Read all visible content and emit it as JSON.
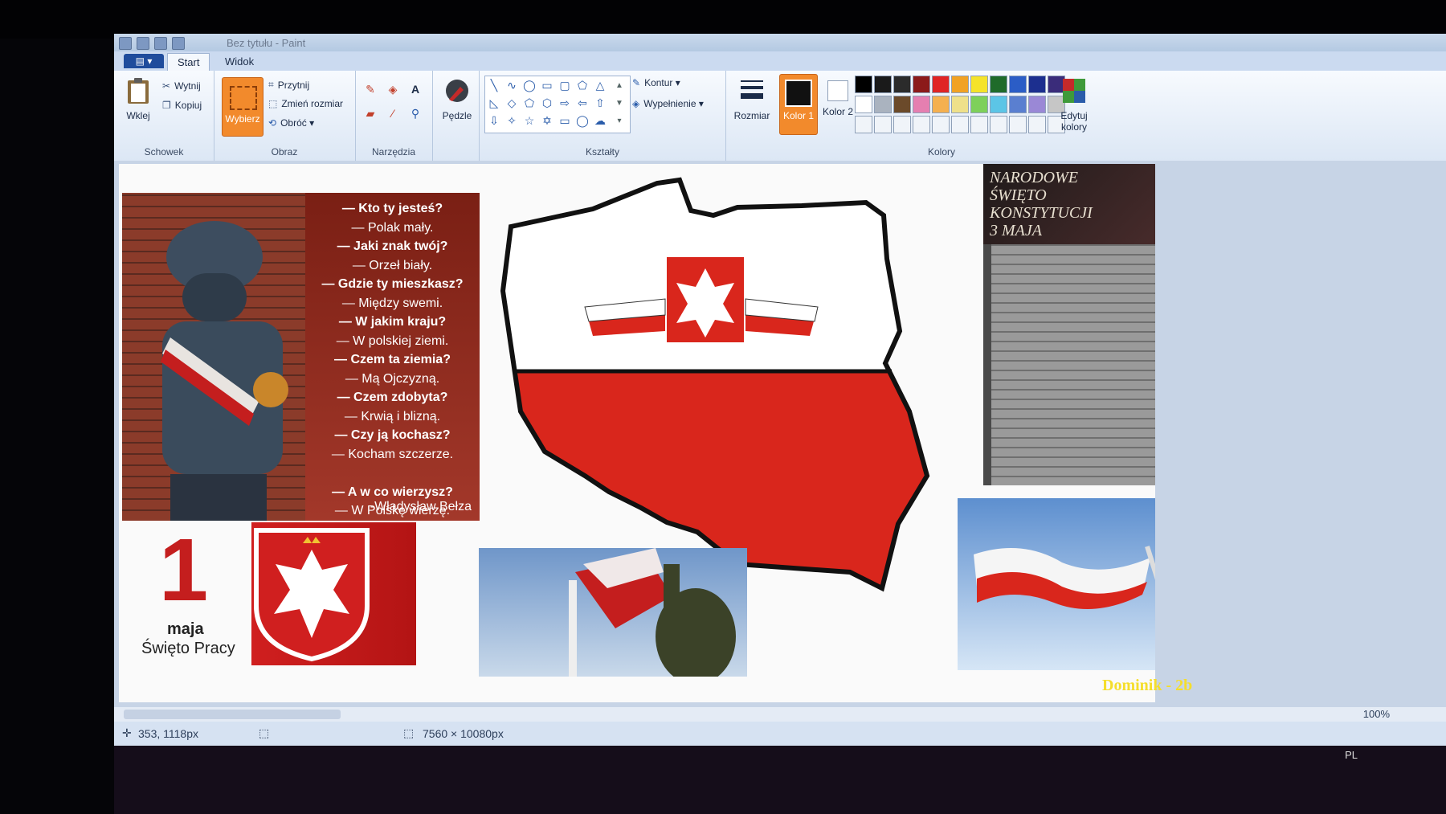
{
  "window": {
    "title": "Bez tytułu - Paint"
  },
  "tabs": {
    "file": "▤ ▾",
    "start": "Start",
    "view": "Widok"
  },
  "clipboard": {
    "paste": "Wklej",
    "cut": "Wytnij",
    "copy": "Kopiuj",
    "label": "Schowek"
  },
  "image": {
    "select": "Wybierz",
    "crop": "Przytnij",
    "resize": "Zmień rozmiar",
    "rotate": "Obróć ▾",
    "label": "Obraz"
  },
  "tools": {
    "label": "Narzędzia",
    "brushes": "Pędzle"
  },
  "shapes": {
    "outline": "Kontur ▾",
    "fill": "Wypełnienie ▾",
    "label": "Kształty"
  },
  "size": {
    "label": "Rozmiar"
  },
  "colors": {
    "color1": "Kolor 1",
    "color2": "Kolor 2",
    "edit": "Edytuj kolory",
    "label": "Kolory",
    "color1_value": "#111111",
    "color2_value": "#ffffff",
    "palette_row1": [
      "#000000",
      "#1a1a1a",
      "#2b2b2b",
      "#8c1a1a",
      "#e02424",
      "#f1a224",
      "#f5e32a",
      "#1f6b2a",
      "#2b5dc6",
      "#1c2f8f",
      "#3a2c7a"
    ],
    "palette_row2": [
      "#ffffff",
      "#aab3bf",
      "#6b4a2a",
      "#e57fb0",
      "#f5b04f",
      "#efe08a",
      "#7ed05a",
      "#5cc5e6",
      "#5a7fd0",
      "#9a88d6",
      "#c6c6c6"
    ],
    "palette_row3": [
      "#f0f4f9",
      "#f0f4f9",
      "#f0f4f9",
      "#f0f4f9",
      "#f0f4f9",
      "#f0f4f9",
      "#f0f4f9",
      "#f0f4f9",
      "#f0f4f9",
      "#f0f4f9",
      "#f0f4f9"
    ]
  },
  "poem": {
    "lines": [
      {
        "text": "— Kto ty jesteś?",
        "bold": true
      },
      {
        "text": "— Polak mały.",
        "bold": false
      },
      {
        "text": "— Jaki znak twój?",
        "bold": true
      },
      {
        "text": "— Orzeł biały.",
        "bold": false
      },
      {
        "text": "— Gdzie ty mieszkasz?",
        "bold": true
      },
      {
        "text": "— Między swemi.",
        "bold": false
      },
      {
        "text": "— W jakim kraju?",
        "bold": true
      },
      {
        "text": "— W polskiej ziemi.",
        "bold": false
      },
      {
        "text": "— Czem ta ziemia?",
        "bold": true
      },
      {
        "text": "— Mą Ojczyzną.",
        "bold": false
      },
      {
        "text": "— Czem zdobyta?",
        "bold": true
      },
      {
        "text": "— Krwią i blizną.",
        "bold": false
      },
      {
        "text": "— Czy ją kochasz?",
        "bold": true
      },
      {
        "text": "— Kocham szczerze.",
        "bold": false
      },
      {
        "text": "",
        "bold": false
      },
      {
        "text": "— A w co wierzysz?",
        "bold": true
      },
      {
        "text": "— W Polskę wierzę.",
        "bold": false
      }
    ],
    "author": "-Władysław Bełza"
  },
  "maj": {
    "number": "1",
    "month": "maja",
    "holiday": "Święto Pracy"
  },
  "konstytucja": {
    "title": "Narodowe Święto Konstytucji 3 Maja"
  },
  "status": {
    "coords": "353, 1118px",
    "size": "7560 × 10080px",
    "zoom": "100%",
    "lang": "PL"
  },
  "watermark": "Dominik - 2b"
}
